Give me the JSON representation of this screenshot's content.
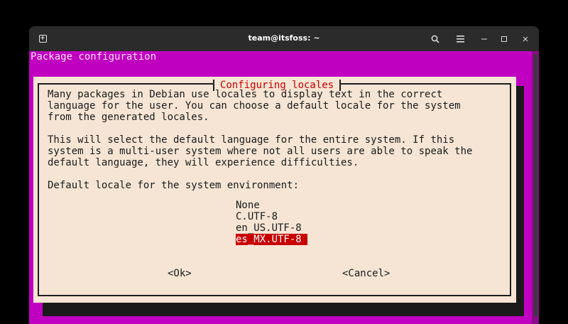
{
  "window": {
    "title": "team@itsfoss: ~"
  },
  "titlebar_icons": {
    "new_tab": "new-tab-icon",
    "search": "search-icon",
    "menu": "hamburger-menu-icon",
    "minimize": "minimize-icon",
    "maximize": "maximize-icon",
    "close": "close-icon"
  },
  "terminal": {
    "header": "Package configuration"
  },
  "dialog": {
    "title": "Configuring locales",
    "paragraph1": "Many packages in Debian use locales to display text in the correct\nlanguage for the user. You can choose a default locale for the system\nfrom the generated locales.",
    "paragraph2": "This will select the default language for the entire system. If this\nsystem is a multi-user system where not all users are able to speak the\ndefault language, they will experience difficulties.",
    "prompt": "Default locale for the system environment:",
    "options": [
      "None",
      "C.UTF-8",
      "en_US.UTF-8",
      "es_MX.UTF-8"
    ],
    "selected_option": "es_MX.UTF-8",
    "ok_label": "<Ok>",
    "cancel_label": "<Cancel>"
  },
  "colors": {
    "terminal_bg": "#c000c0",
    "dialog_bg": "#f6e5d4",
    "title_red": "#c80000",
    "selection_bg": "#c80000"
  }
}
